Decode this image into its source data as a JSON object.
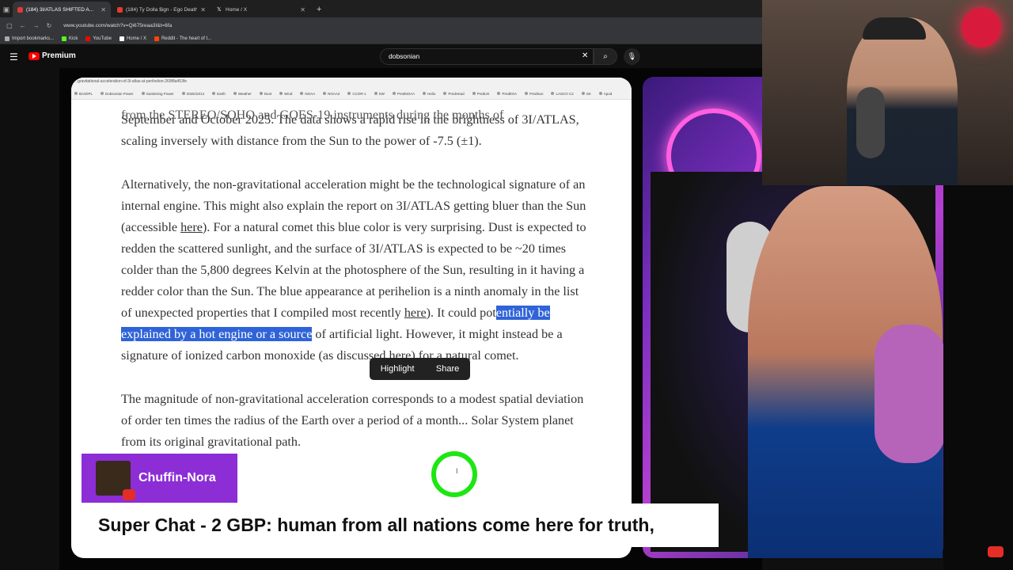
{
  "browser": {
    "tabs": [
      {
        "title": "(184) 3I/ATLAS SHIFTED A...",
        "active": true
      },
      {
        "title": "(184) Ty Dolla $ign - Ego Death",
        "active": false
      },
      {
        "title": "Home / X",
        "active": false
      }
    ],
    "new_tab": "+",
    "url": "www.youtube.com/watch?v=Qi675reaa3I&t=6fa",
    "bookmarks": [
      "Import bookmarks...",
      "Kick",
      "YouTube",
      "Home / X",
      "Reddit - The heart of t..."
    ]
  },
  "youtube": {
    "logo": "Premium",
    "search_value": "dobsonian"
  },
  "article": {
    "url": "...gravitational-acceleration-of-3i-atlas-at-perihelion-269f8a453fe",
    "bookmarks": [
      "BAS/IPL",
      "Dobsonian Power",
      "Gardening Power",
      "2025/10/14",
      "Earth",
      "Weather",
      "Dust",
      "Wind",
      "NOAA",
      "NOAA2",
      "CCOR-1",
      "SW",
      "PredNOAA",
      "Helio",
      "PredHead",
      "PredUK",
      "PredESA",
      "PredSun",
      "LASCO C2",
      "SK",
      "Apod"
    ],
    "line_cut": "from the STEREO/SOHO and GOES-19 instruments during the months of",
    "p1": "September and October 2025. The data shows a rapid rise in the brightness of 3I/ATLAS, scaling inversely with distance from the Sun to the power of -7.5 (±1).",
    "p2_a": "Alternatively, the non-gravitational acceleration might be the technological signature of an internal engine. This might also explain the report on 3I/ATLAS getting bluer than the Sun (accessible ",
    "p2_link1": "here",
    "p2_b": "). For a natural comet this blue color is very surprising. Dust is expected to redden the scattered sunlight, and the surface of 3I/ATLAS is expected to be ~20 times colder than the 5,800 degrees Kelvin at the photosphere of the Sun, resulting in it having a redder color than the Sun. The blue appearance at perihelion is a ninth anomaly in the list of unexpected properties that I compiled most recently ",
    "p2_link2": "here",
    "p2_c": "). It could pot",
    "p2_sel": "entially be explained by a hot engine or a source",
    "p2_d": " of artificial light. However, it might instead be a signature of ionized carbon monoxide (as discussed ",
    "p2_link3": "here",
    "p2_e": ") for a natural comet.",
    "p3": "The magnitude of non-gravitational acceleration corresponds to a modest spatial deviation of order ten times the radius of the Earth over a period of a month... Solar System planet from its original gravitational path."
  },
  "selection_popup": {
    "highlight": "Highlight",
    "share": "Share"
  },
  "overlay": {
    "chatter_name": "Chuffin-Nora",
    "superchat": "Super Chat - 2 GBP: human from all nations come here for truth,"
  }
}
